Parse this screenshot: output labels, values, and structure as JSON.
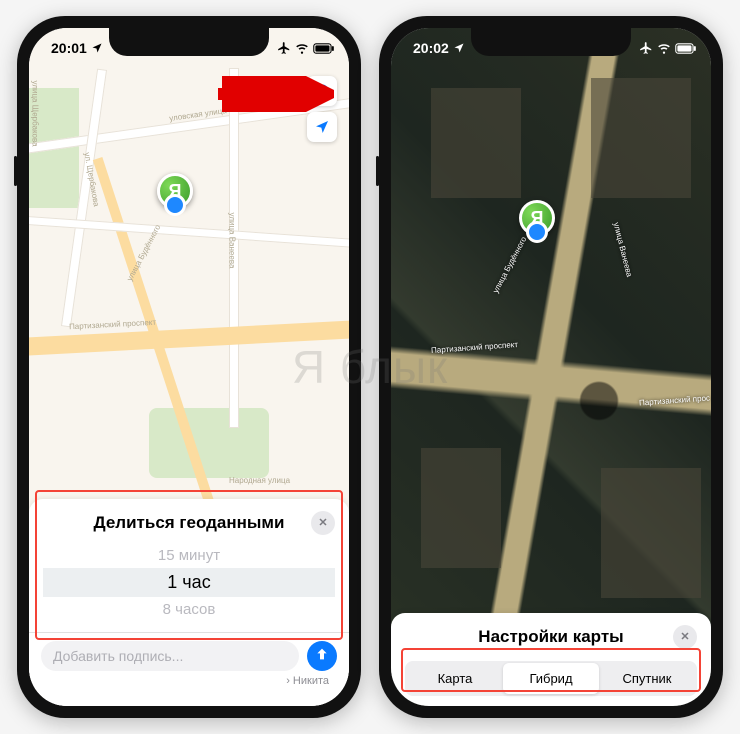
{
  "watermark": "Я блык",
  "left": {
    "status": {
      "time": "20:01"
    },
    "avatar_letter": "Я",
    "map_labels": {
      "partizansky": "Партизанский проспект",
      "vaneeva": "улица Ванеева",
      "shcherbakova": "ул. Щербакова",
      "ulovskaya": "уловская улица",
      "narodnaya": "Народная улица",
      "shcherbakova2": "улица Щербакова",
      "budyonnogo": "улица Будённого"
    },
    "sheet": {
      "title": "Делиться геоданными",
      "options": [
        "15 минут",
        "1 час",
        "8 часов"
      ],
      "selected_index": 1
    },
    "caption": {
      "placeholder": "Добавить подпись...",
      "recipient_prefix": "›",
      "recipient": "Никита"
    }
  },
  "right": {
    "status": {
      "time": "20:02"
    },
    "avatar_letter": "Я",
    "map_labels": {
      "partizansky": "Партизанский проспект",
      "vaneeva": "улица Ванеева",
      "partizansky2": "Партизанский прос",
      "budyonnogo": "улица Будённого"
    },
    "sheet": {
      "title": "Настройки карты",
      "segments": [
        "Карта",
        "Гибрид",
        "Спутник"
      ],
      "selected_index": 1
    }
  }
}
